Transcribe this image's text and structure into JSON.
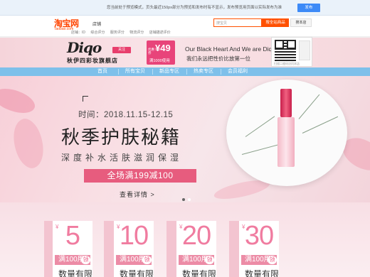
{
  "notice": {
    "text": "您当前处于预览模式，页头最近150px部分为预览和发布时有不显示，发布预览用页面以实际发布为准",
    "button": "发布"
  },
  "header": {
    "logo": "淘宝网",
    "logo_sub": "Taobao.com",
    "shop_label": "店铺",
    "search_placeholder": "搜宝贝",
    "search_button": "搜全站商品",
    "search_shop_button": "搜本店",
    "row2": [
      "店铺：ID",
      "综合评分",
      "服务评分",
      "物流评分",
      "店铺描述评价"
    ]
  },
  "banner": {
    "brand": "Diqo",
    "brand_cn": "秋伊四彩妆旗舰店",
    "follow": "关注",
    "coupon_value": "¥49",
    "coupon_label": "优惠券",
    "coupon_cond": "满1000使用",
    "slogan_en": "Our Black Heart And We are Diqo",
    "slogan_cn": "我们永远把性价比放第一位"
  },
  "qr": {
    "caption": "扫描二维码访问本店"
  },
  "nav": {
    "items": [
      "首页",
      "所有宝贝",
      "新品专区",
      "热卖专区",
      "会员福利"
    ]
  },
  "hero": {
    "time": "时间：2018.11.15-12.15",
    "title": "秋季护肤秘籍",
    "subtitle": "深度补水活肤滋润保湿",
    "deal": "全场满199减100",
    "detail": "查看详情 >"
  },
  "coupons": [
    {
      "yen": "¥",
      "amount": "5",
      "condition": "满100用",
      "get": "领",
      "limit": "数量有限"
    },
    {
      "yen": "¥",
      "amount": "10",
      "condition": "满100用",
      "get": "领",
      "limit": "数量有限"
    },
    {
      "yen": "¥",
      "amount": "20",
      "condition": "满100用",
      "get": "领",
      "limit": "数量有限"
    },
    {
      "yen": "¥",
      "amount": "30",
      "condition": "满100用",
      "get": "领",
      "limit": "数量有限"
    }
  ],
  "colors": {
    "taobao_orange": "#ff5000",
    "accent_pink": "#e75c7e",
    "nav_blue": "#7ec0ea"
  }
}
